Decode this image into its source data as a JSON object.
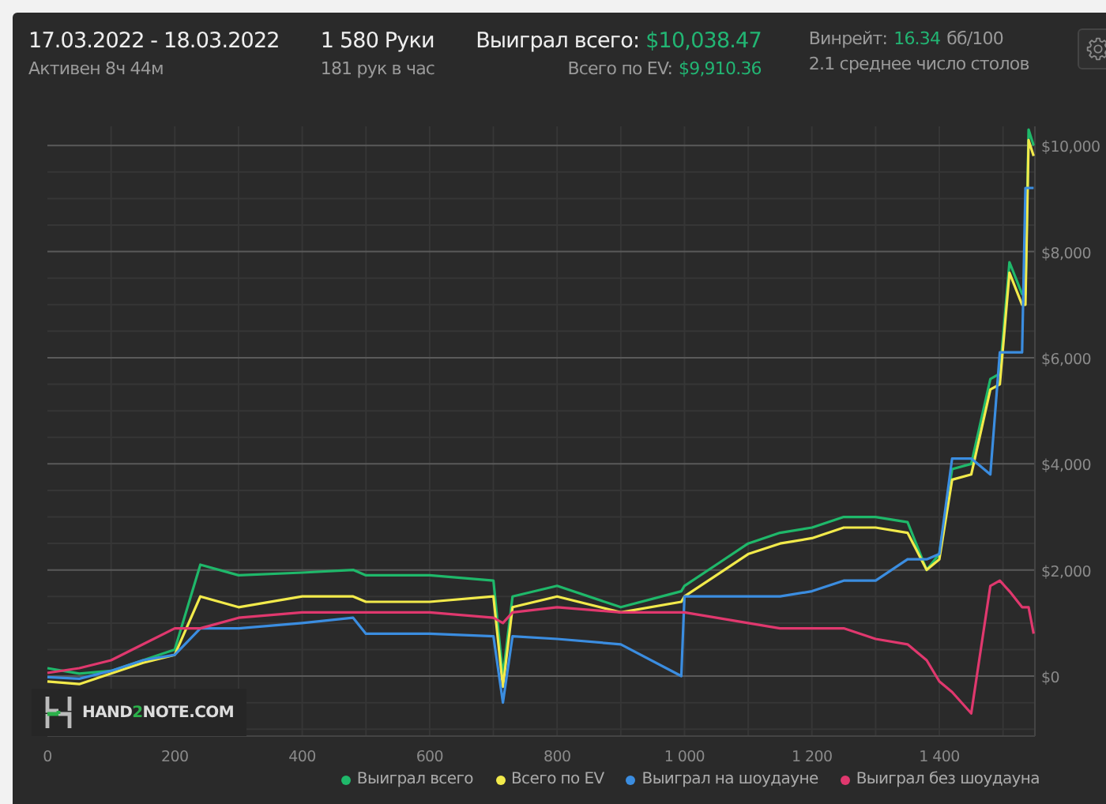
{
  "header": {
    "dates": "17.03.2022 - 18.03.2022",
    "active": "Активен 8ч 44м",
    "hands": "1 580 Руки",
    "hands_per_hour": "181 рук в час",
    "won_label": "Выиграл всего:",
    "won_value": "$10,038.47",
    "ev_label": "Всего по EV:",
    "ev_value": "$9,910.36",
    "winrate_label": "Винрейт:",
    "winrate_value": "16.34",
    "winrate_unit": "бб/100",
    "tables": "2.1 среднее число столов"
  },
  "logo": {
    "parts": [
      "HAND",
      "2",
      "NOTE.COM"
    ]
  },
  "chart_data": {
    "type": "line",
    "grid": true,
    "x": [
      0,
      50,
      100,
      150,
      200,
      240,
      300,
      400,
      480,
      500,
      600,
      700,
      715,
      730,
      800,
      900,
      995,
      1000,
      1050,
      1100,
      1150,
      1200,
      1250,
      1300,
      1350,
      1380,
      1400,
      1420,
      1450,
      1480,
      1495,
      1510,
      1530,
      1535,
      1540,
      1548
    ],
    "xlim": [
      0,
      1550
    ],
    "ylim": [
      -1130,
      10360
    ],
    "xticks": [
      {
        "value": 0,
        "label": "0"
      },
      {
        "value": 200,
        "label": "200"
      },
      {
        "value": 400,
        "label": "400"
      },
      {
        "value": 600,
        "label": "600"
      },
      {
        "value": 800,
        "label": "800"
      },
      {
        "value": 1000,
        "label": "1 000"
      },
      {
        "value": 1200,
        "label": "1 200"
      },
      {
        "value": 1400,
        "label": "1 400"
      }
    ],
    "yticks": [
      {
        "value": 0,
        "label": "$0"
      },
      {
        "value": 2000,
        "label": "$2,000"
      },
      {
        "value": 4000,
        "label": "$4,000"
      },
      {
        "value": 6000,
        "label": "$6,000"
      },
      {
        "value": 8000,
        "label": "$8,000"
      },
      {
        "value": 10000,
        "label": "$10,000"
      }
    ],
    "series": [
      {
        "name": "Выиграл всего",
        "color": "#1fb86a",
        "values": [
          150,
          50,
          100,
          300,
          500,
          2100,
          1900,
          1950,
          2000,
          1900,
          1900,
          1800,
          0,
          1500,
          1700,
          1300,
          1600,
          1700,
          2100,
          2500,
          2700,
          2800,
          3000,
          3000,
          2900,
          2000,
          2300,
          3900,
          4000,
          5600,
          5700,
          7800,
          7200,
          7200,
          10300,
          10000
        ]
      },
      {
        "name": "Всего по EV",
        "color": "#f2ea4b",
        "values": [
          -100,
          -150,
          50,
          250,
          400,
          1500,
          1300,
          1500,
          1500,
          1400,
          1400,
          1500,
          -200,
          1300,
          1500,
          1200,
          1400,
          1500,
          1900,
          2300,
          2500,
          2600,
          2800,
          2800,
          2700,
          2000,
          2200,
          3700,
          3800,
          5400,
          5500,
          7600,
          7000,
          7000,
          10100,
          9800
        ]
      },
      {
        "name": "Выиграл на шоудауне",
        "color": "#3b8de0",
        "values": [
          -20,
          -50,
          100,
          300,
          400,
          900,
          900,
          1000,
          1100,
          800,
          800,
          750,
          -500,
          750,
          700,
          600,
          0,
          1500,
          1500,
          1500,
          1500,
          1600,
          1800,
          1800,
          2200,
          2200,
          2300,
          4100,
          4100,
          3800,
          6100,
          6100,
          6100,
          9200,
          9200,
          9200
        ]
      },
      {
        "name": "Выиграл без шоудауна",
        "color": "#e0386e",
        "values": [
          60,
          150,
          300,
          600,
          900,
          900,
          1100,
          1200,
          1200,
          1200,
          1200,
          1100,
          1000,
          1200,
          1300,
          1200,
          1200,
          1200,
          1100,
          1000,
          900,
          900,
          900,
          700,
          600,
          300,
          -100,
          -300,
          -700,
          1700,
          1800,
          1600,
          1300,
          1300,
          1300,
          800
        ]
      }
    ]
  }
}
